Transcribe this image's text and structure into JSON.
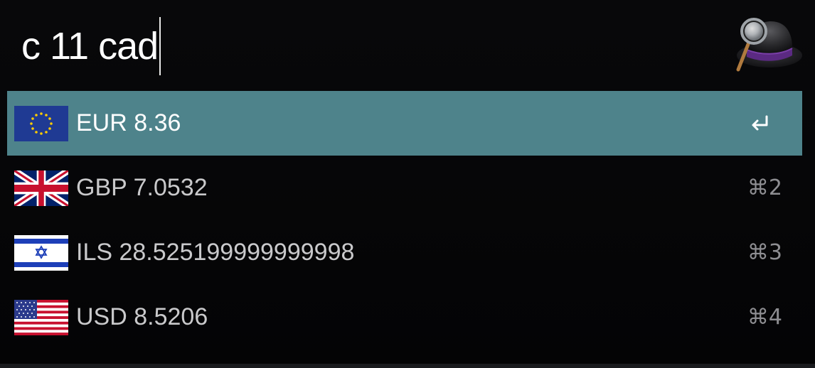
{
  "search": {
    "query": "c 11 cad"
  },
  "results": [
    {
      "flag": "eu-flag-icon",
      "label": "EUR 8.36",
      "shortcut": "↩",
      "selected": true
    },
    {
      "flag": "uk-flag-icon",
      "label": "GBP 7.0532",
      "shortcut": "⌘2",
      "selected": false
    },
    {
      "flag": "israel-flag-icon",
      "label": "ILS 28.525199999999998",
      "shortcut": "⌘3",
      "selected": false
    },
    {
      "flag": "us-flag-icon",
      "label": "USD 8.5206",
      "shortcut": "⌘4",
      "selected": false
    }
  ],
  "icons": {
    "app_logo": "alfred-hat-icon",
    "return": "return-key-icon"
  },
  "colors": {
    "selection": "#4e838b",
    "background": "#050506",
    "text_primary": "#ffffff",
    "text_secondary": "#c9c9cb",
    "shortcut": "#8e8e92"
  }
}
